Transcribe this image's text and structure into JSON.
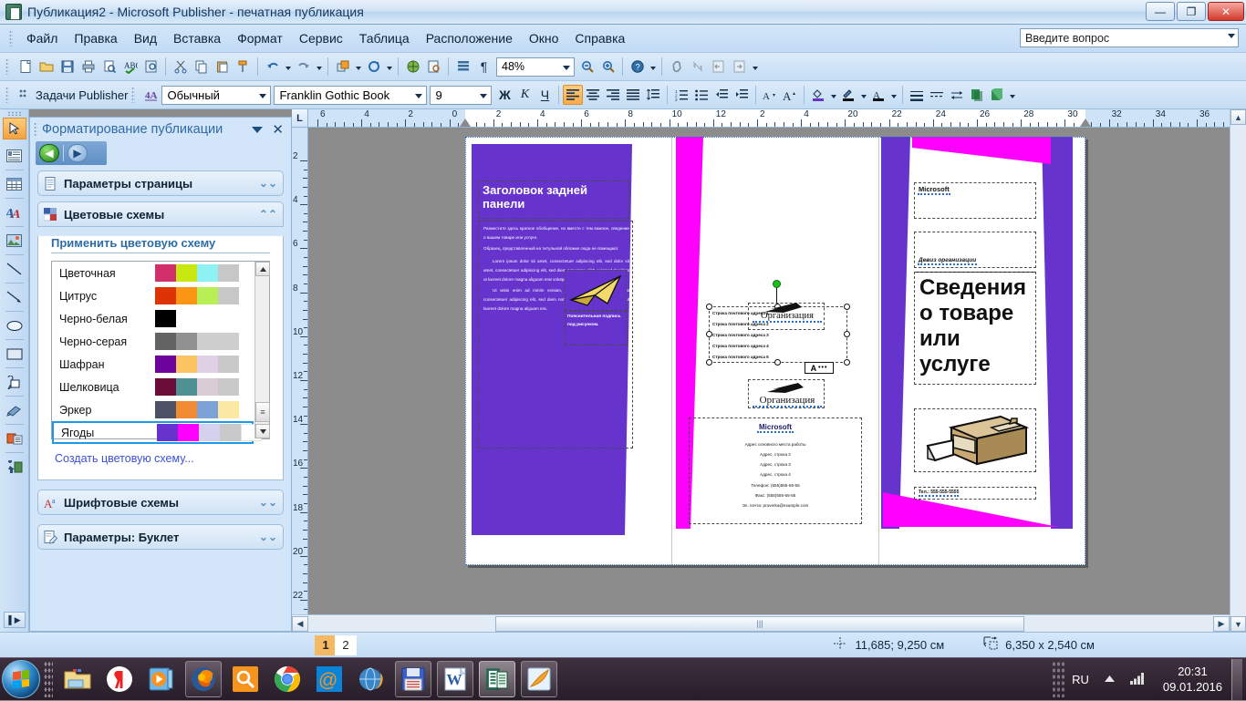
{
  "window": {
    "title": "Публикация2 - Microsoft Publisher - печатная публикация",
    "minimize": "—",
    "maximize": "❐",
    "close": "✕"
  },
  "menubar": {
    "items": [
      "Файл",
      "Правка",
      "Вид",
      "Вставка",
      "Формат",
      "Сервис",
      "Таблица",
      "Расположение",
      "Окно",
      "Справка"
    ],
    "ask_placeholder": "Введите вопрос"
  },
  "toolbar_standard": {
    "zoom_value": "48%",
    "icons": [
      "new-document-icon",
      "open-folder-icon",
      "save-icon",
      "print-icon",
      "print-preview-icon",
      "spellcheck-icon",
      "research-icon",
      "cut-icon",
      "copy-icon",
      "paste-icon",
      "format-painter-icon",
      "undo-icon",
      "redo-icon",
      "bring-to-front-icon",
      "rotate-icon",
      "design-gallery-icon",
      "design-checker-icon",
      "special-characters-icon",
      "show-formatting-icon",
      "zoom-out-icon",
      "zoom-in-icon",
      "help-icon",
      "hyperlink-icon",
      "break-link-icon",
      "previous-frame-icon",
      "next-frame-icon"
    ]
  },
  "toolbar_formatting": {
    "publisher_tasks": "Задачи Publisher",
    "style": "Обычный",
    "font": "Franklin Gothic Book",
    "size": "9",
    "bold": "Ж",
    "italic": "К",
    "underline": "Ч",
    "align_left": "align-left-icon",
    "align_center": "align-center-icon",
    "align_right": "align-right-icon",
    "align_justify": "align-justify-icon",
    "line_spacing": "line-spacing-icon",
    "numbered_list": "numbered-list-icon",
    "bulleted_list": "bulleted-list-icon",
    "decrease_indent": "decrease-indent-icon",
    "increase_indent": "increase-indent-icon",
    "decrease_font": "decrease-font-icon",
    "increase_font": "increase-font-icon",
    "fill_color": "fill-color-icon",
    "line_color": "line-color-icon",
    "font_color": "font-color-icon",
    "line_style": "line-style-icon",
    "dash_style": "dash-style-icon",
    "arrow_style": "arrow-style-icon",
    "shadow_style": "shadow-style-icon",
    "three_d_style": "3d-style-icon"
  },
  "objects_toolbar": {
    "items": [
      {
        "name": "select-objects-tool",
        "label": "Выбор объектов",
        "active": true
      },
      {
        "name": "text-box-tool",
        "label": "Надпись"
      },
      {
        "name": "insert-table-tool",
        "label": "Вставить таблицу"
      },
      {
        "name": "wordart-tool",
        "label": "Объект WordArt"
      },
      {
        "name": "picture-frame-tool",
        "label": "Рамка рисунка"
      },
      {
        "name": "line-tool",
        "label": "Линия"
      },
      {
        "name": "arrow-tool",
        "label": "Стрелка"
      },
      {
        "name": "oval-tool",
        "label": "Овал"
      },
      {
        "name": "rectangle-tool",
        "label": "Прямоугольник"
      },
      {
        "name": "autoshapes-tool",
        "label": "Автофигуры"
      },
      {
        "name": "design-gallery-tool",
        "label": "Коллекция макетов"
      },
      {
        "name": "item-from-content-library-tool",
        "label": "Элемент из библиотеки"
      },
      {
        "name": "design-gallery-object-tool",
        "label": "Объект коллекции"
      }
    ],
    "expand": "▌▶"
  },
  "taskpane": {
    "title": "Форматирование публикации",
    "dropdown_icon": "chevron-down-icon",
    "close_icon": "close-icon",
    "back_icon": "back-arrow-icon",
    "forward_icon": "forward-arrow-icon",
    "sections": [
      {
        "title": "Параметры страницы",
        "icon": "page-setup-icon",
        "chevron": "«",
        "expanded": false
      },
      {
        "title": "Цветовые схемы",
        "icon": "color-schemes-icon",
        "chevron": "«",
        "expanded": true
      },
      {
        "title": "Шрифтовые схемы",
        "icon": "font-schemes-icon",
        "chevron": "«",
        "expanded": false
      },
      {
        "title": "Параметры: Буклет",
        "icon": "publication-options-icon",
        "chevron": "«",
        "expanded": false
      }
    ],
    "apply_label": "Применить цветовую схему",
    "create_link": "Создать цветовую схему...",
    "schemes": [
      {
        "name": "Цветочная",
        "colors": [
          "#d2306a",
          "#c9e812",
          "#8ef2f5",
          "#c7c7c7"
        ]
      },
      {
        "name": "Цитрус",
        "colors": [
          "#dd3305",
          "#fb9614",
          "#b8ef55",
          "#c7c7c7"
        ]
      },
      {
        "name": "Черно-белая",
        "colors": [
          "#000000"
        ]
      },
      {
        "name": "Черно-серая",
        "colors": [
          "#636363",
          "#919191",
          "#cfcfcf",
          "#cfcfcf"
        ]
      },
      {
        "name": "Шафран",
        "colors": [
          "#6e039c",
          "#fbc463",
          "#dfd0e6",
          "#c9c9c9"
        ]
      },
      {
        "name": "Шелковица",
        "colors": [
          "#6b0b38",
          "#4f9094",
          "#dbcbd4",
          "#c9c9c9"
        ]
      },
      {
        "name": "Эркер",
        "colors": [
          "#4b5266",
          "#f08b33",
          "#7da2d8",
          "#fbe9a3"
        ]
      },
      {
        "name": "Ягоды",
        "colors": [
          "#6633cc",
          "#ff00ff",
          "#d6d0ef",
          "#c9c9c9",
          "#ffffff"
        ],
        "selected": true
      }
    ],
    "scroll_up_icon": "scroll-up-arrow-icon",
    "scroll_down_icon": "scroll-down-arrow-icon"
  },
  "ruler": {
    "corner_label": "L",
    "h_labels": [
      "6",
      "4",
      "2",
      "0",
      "2",
      "4",
      "6",
      "8",
      "10",
      "12",
      "2",
      "4",
      "20",
      "22",
      "24",
      "26",
      "28",
      "30",
      "32",
      "34",
      "36"
    ],
    "v_labels": [
      "2",
      "4",
      "6",
      "8",
      "10",
      "12",
      "14",
      "16",
      "18",
      "20",
      "22"
    ]
  },
  "document": {
    "back_panel": {
      "heading": "Заголовок задней панели",
      "paragraphs": [
        "Разместите здесь краткое обобщение, но вместе с тем важное, сведение о вашем товаре или услуге.",
        "Образец, представленный на титульной обложке сюда не помещают.",
        "Lorem ipsum dolor sit amet, consectetuer adipiscing elit, sed dolor sit amet, consectetuer adipiscing elit, sed diem nonummy nibh euismod tincidunt ut lacreet dolore magna aliguam erat volutpat.",
        "Ut wisis enim ad minim veniam, quis nostrud exerci tution ullat consectetuer adipiscing elit, sed diem nonummy nibh euismod tinci dunt ut laoreet dolore magna aliguam era."
      ],
      "caption": "Пояснительная подпись под рисунком.",
      "logo_icon": "paper-plane-logo-icon"
    },
    "middle_panel": {
      "address_lines": [
        "Строка почтового адреса 1",
        "Строка почтового адреса 2",
        "Строка почтового адреса 3",
        "Строка почтового адреса 4",
        "Строка почтового адреса 5"
      ],
      "org_name_overlay": "Организация",
      "org_name_lower": "Организация",
      "company": "Microsoft",
      "contact_lines": [
        "Адрес основного места работы",
        "Адрес, строка 2",
        "Адрес, строка 3",
        "Адрес, строка 4",
        "Телефон: (555)555-55-55",
        "Факс: (555)555-55-55",
        "Эл. почта: proverka@example.com"
      ],
      "smarttag_icon": "text-overflow-icon"
    },
    "front_panel": {
      "company": "Microsoft",
      "tagline": "Девиз организации",
      "title": "Сведения о товаре или услуге",
      "phone": "Тел.: 555-555-5555",
      "image_icon": "printer-image-icon"
    }
  },
  "statusbar": {
    "pages": [
      "1",
      "2"
    ],
    "position_icon": "cursor-position-icon",
    "position": "11,685; 9,250 см",
    "size_icon": "object-size-icon",
    "size": "6,350 x  2,540 см"
  },
  "scrollbars": {
    "left_arrow": "◀",
    "right_arrow": "▶",
    "up_arrow": "▲",
    "down_arrow": "▼",
    "thumb_grip": "|||"
  },
  "taskbar": {
    "start": "start-orb-icon",
    "items": [
      {
        "name": "explorer-icon",
        "label": "Проводник"
      },
      {
        "name": "yandex-browser-icon",
        "label": "Яндекс.Браузер"
      },
      {
        "name": "media-player-icon",
        "label": "Проигрыватель"
      },
      {
        "name": "firefox-icon",
        "label": "Mozilla Firefox",
        "framed": true
      },
      {
        "name": "search-icon",
        "label": "Поиск"
      },
      {
        "name": "chrome-icon",
        "label": "Google Chrome"
      },
      {
        "name": "mailru-icon",
        "label": "Mail.ru"
      },
      {
        "name": "globe-browser-icon",
        "label": "Браузер"
      },
      {
        "name": "save-window-icon",
        "label": "Сохранение",
        "framed": true
      },
      {
        "name": "word-window-icon",
        "label": "Microsoft Word",
        "framed": true
      },
      {
        "name": "publisher-window-icon",
        "label": "Microsoft Publisher",
        "active": true
      },
      {
        "name": "image-viewer-icon",
        "label": "Просмотр изображений",
        "framed": true
      }
    ],
    "language": "RU",
    "show_hidden_icon": "show-hidden-icons-icon",
    "network_icon": "network-signal-icon",
    "time": "20:31",
    "date": "09.01.2016"
  }
}
